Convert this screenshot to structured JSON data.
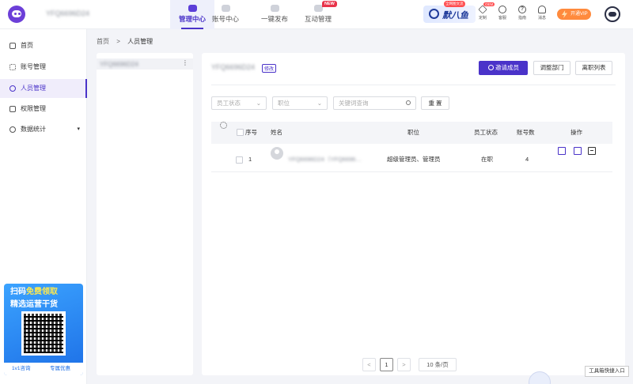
{
  "topbar": {
    "org_name": "YFQ6696D24",
    "nav": [
      {
        "label": "管理中心",
        "active": true
      },
      {
        "label": "账号中心",
        "active": false
      },
      {
        "label": "一键发布",
        "active": false
      },
      {
        "label": "互动管理",
        "active": false
      }
    ],
    "new_badge": "NEW",
    "brand": {
      "name": "默八鱼",
      "tag": "全网图文流"
    },
    "tools": [
      {
        "label": "定制",
        "icon": "diamond-icon"
      },
      {
        "label": "客服",
        "icon": "headset-icon"
      },
      {
        "label": "指南",
        "icon": "question-icon"
      },
      {
        "label": "消息",
        "icon": "bell-icon"
      }
    ],
    "tool_badge": "OEM",
    "vip_label": "开通VIP"
  },
  "sidebar": {
    "items": [
      {
        "label": "首页",
        "icon": "home-icon"
      },
      {
        "label": "账号管理",
        "icon": "grid-icon"
      },
      {
        "label": "人员管理",
        "icon": "user-icon",
        "active": true
      },
      {
        "label": "权限管理",
        "icon": "lock-icon"
      },
      {
        "label": "数据统计",
        "icon": "chart-icon",
        "expandable": true
      }
    ],
    "promo": {
      "line1_a": "扫码",
      "line1_b": "免费领取",
      "line2": "精选运营干货",
      "consult": "1v1咨询",
      "offer": "专属优惠"
    }
  },
  "breadcrumb": {
    "home": "首页",
    "sep": ">",
    "current": "人员管理"
  },
  "dept_panel": {
    "root_name": "YFQ6696D24",
    "more": "⋮"
  },
  "main": {
    "title": "YFQ6696D24",
    "edit_label": "修改",
    "buttons": {
      "invite": "邀请成员",
      "adjust": "调整部门",
      "resigned": "离职列表"
    },
    "filters": {
      "status_placeholder": "员工状态",
      "position_placeholder": "职位",
      "keyword_placeholder": "关键词查询",
      "reset": "重 置"
    },
    "table": {
      "headers": [
        "序号",
        "姓名",
        "职位",
        "员工状态",
        "账号数",
        "操作"
      ],
      "rows": [
        {
          "index": "1",
          "name": "YFQ6696D24（YFQ6696…",
          "position": "超级管理员、管理员",
          "status": "在职",
          "accounts": "4"
        }
      ]
    },
    "pagination": {
      "prev": "<",
      "page": "1",
      "next": ">",
      "page_size": "10 条/页"
    }
  },
  "floating": {
    "tools_entry": "工具箱快捷入口"
  },
  "colors": {
    "accent": "#4a33c9",
    "danger": "#e8334a",
    "vip": "#ff8a3d",
    "promo": "#1d6fe6"
  }
}
